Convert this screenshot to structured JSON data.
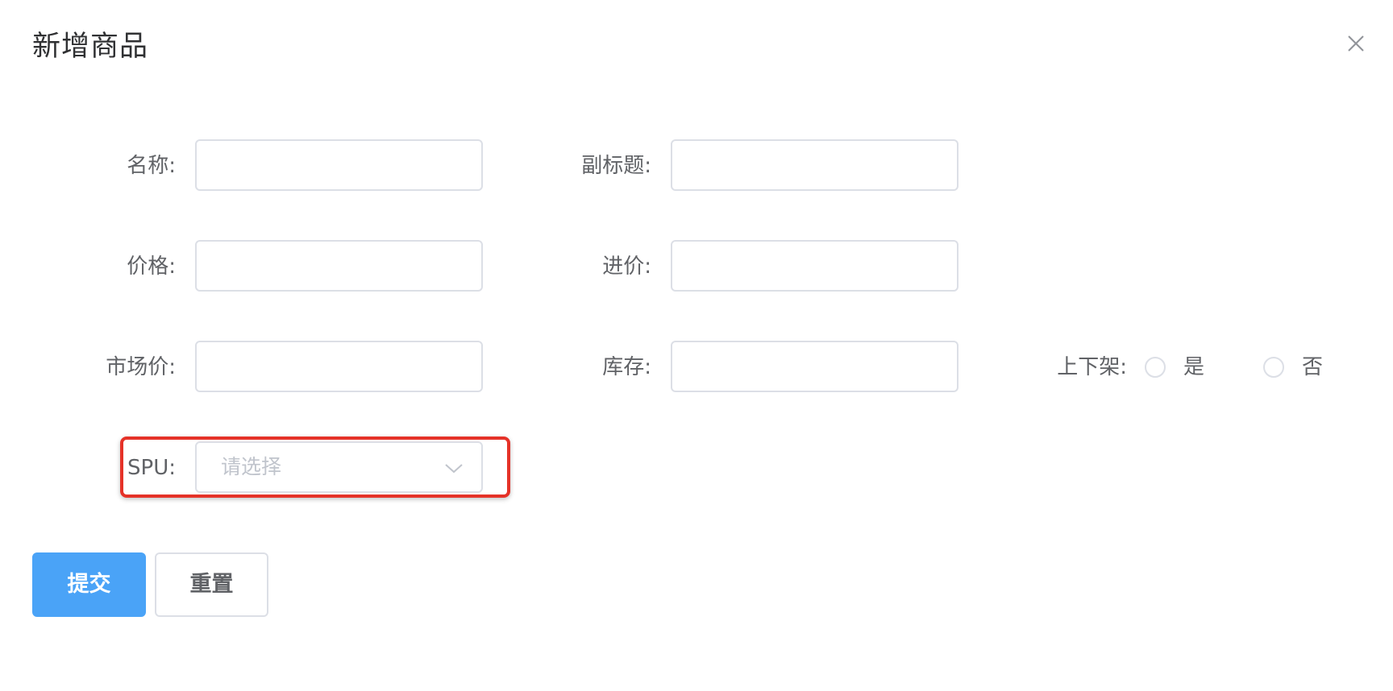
{
  "dialog": {
    "title": "新增商品"
  },
  "form": {
    "name_label": "名称:",
    "subtitle_label": "副标题:",
    "price_label": "价格:",
    "cost_price_label": "进价:",
    "market_price_label": "市场价:",
    "stock_label": "库存:",
    "on_shelf_label": "上下架:",
    "on_shelf_options": [
      "是",
      "否"
    ],
    "spu_label": "SPU:",
    "spu_placeholder": "请选择"
  },
  "actions": {
    "submit_label": "提交",
    "reset_label": "重置"
  },
  "colors": {
    "primary": "#4aa3f7",
    "highlight": "#e53228",
    "border": "#dcdfe6"
  },
  "icons": {
    "close": "close-icon",
    "dropdown": "chevron-down-icon"
  }
}
